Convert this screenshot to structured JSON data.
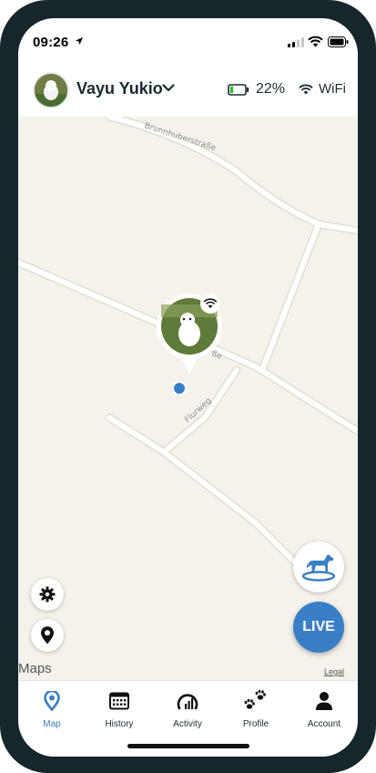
{
  "status_bar": {
    "time": "09:26"
  },
  "header": {
    "dog_name": "Vayu Yukio",
    "battery_percent": "22%",
    "battery_level": 0.22,
    "connection": "WiFi"
  },
  "map": {
    "streets": [
      "Brunnhuberstraße",
      "Flurweg",
      "ße"
    ],
    "attribution": "Maps",
    "legal": "Legal"
  },
  "buttons": {
    "live_label": "LIVE"
  },
  "tabs": [
    {
      "label": "Map",
      "icon": "map-pin-icon",
      "active": true
    },
    {
      "label": "History",
      "icon": "calendar-icon",
      "active": false
    },
    {
      "label": "Activity",
      "icon": "activity-gauge-icon",
      "active": false
    },
    {
      "label": "Profile",
      "icon": "paw-icon",
      "active": false
    },
    {
      "label": "Account",
      "icon": "person-icon",
      "active": false
    }
  ],
  "colors": {
    "accent": "#3a7ec6",
    "frame": "#17262b",
    "map_bg": "#f5f2eb",
    "battery_fill": "#2fbf3b"
  }
}
